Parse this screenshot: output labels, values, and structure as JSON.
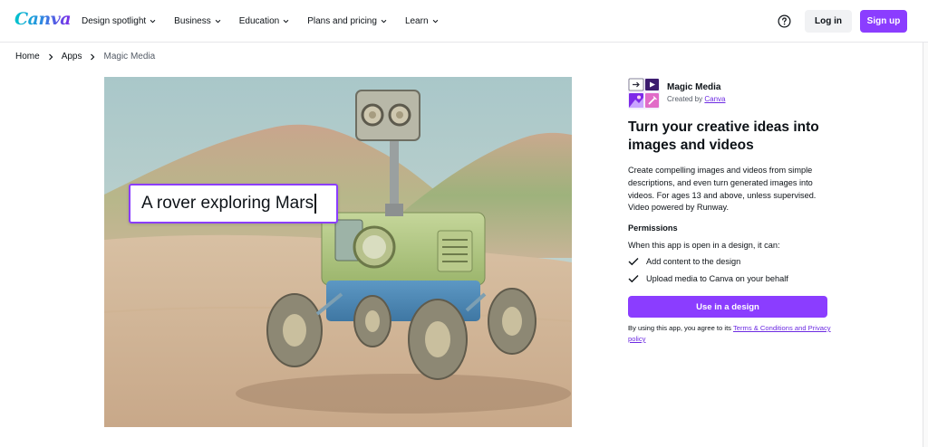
{
  "header": {
    "logo": "Canva",
    "nav": [
      {
        "label": "Design spotlight"
      },
      {
        "label": "Business"
      },
      {
        "label": "Education"
      },
      {
        "label": "Plans and pricing"
      },
      {
        "label": "Learn"
      }
    ],
    "help_icon": "question-circle-icon",
    "login_label": "Log in",
    "signup_label": "Sign up"
  },
  "breadcrumb": {
    "items": [
      "Home",
      "Apps",
      "Magic Media"
    ]
  },
  "hero": {
    "prompt_text": "A rover exploring Mars"
  },
  "app": {
    "name": "Magic Media",
    "created_by_prefix": "Created by",
    "creator": "Canva",
    "headline": "Turn your creative ideas into images and videos",
    "description": "Create compelling images and videos from simple descriptions, and even turn generated images into videos. For ages 13 and above, unless supervised. Video powered by Runway.",
    "permissions_title": "Permissions",
    "permissions_intro": "When this app is open in a design, it can:",
    "permissions": [
      "Add content to the design",
      "Upload media to Canva on your behalf"
    ],
    "cta_label": "Use in a design",
    "terms_prefix": "By using this app, you agree to its ",
    "terms_link": "Terms & Conditions and Privacy policy"
  },
  "colors": {
    "accent": "#8b3dff",
    "link": "#6d2be2",
    "logo_teal": "#00c4cc"
  }
}
